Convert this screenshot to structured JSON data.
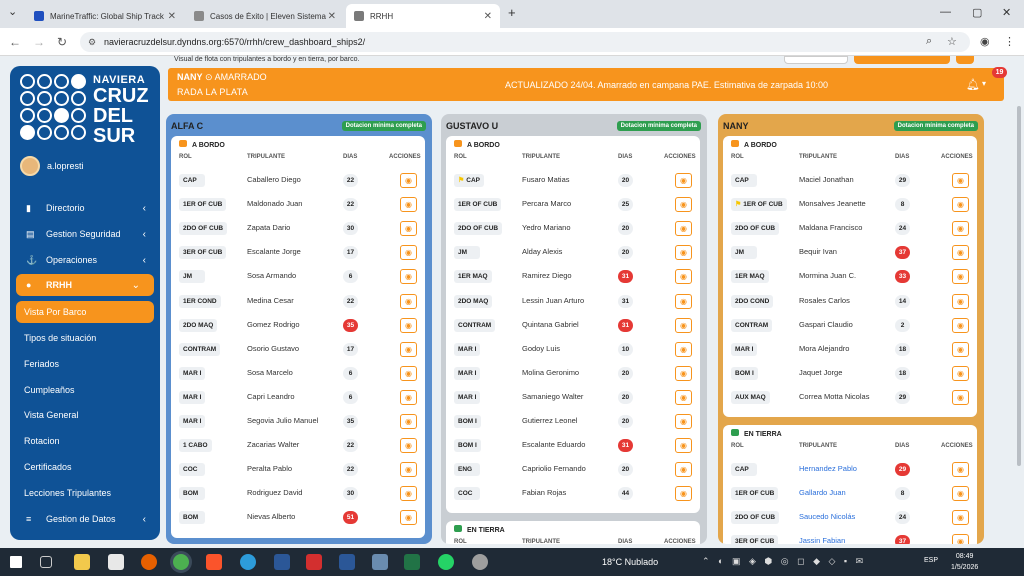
{
  "browser": {
    "tabs": [
      {
        "title": "MarineTraffic: Global Ship Track",
        "fav_color": "#1f4fbf",
        "active": false
      },
      {
        "title": "Casos de Éxito | Eleven Sistema",
        "fav_color": "#8a8a8a",
        "active": false
      },
      {
        "title": "RRHH",
        "fav_color": "#7a7a7a",
        "active": true
      }
    ],
    "new_tab": "+",
    "url": "navieracruzdelsur.dyndns.org:6570/rrhh/crew_dashboard_ships2/"
  },
  "sidebar": {
    "logo": {
      "line1": "NAVIERA",
      "line2": "CRUZ",
      "line3": "DEL",
      "line4": "SUR"
    },
    "user": "a.lopresti",
    "menu": [
      {
        "label": "Directorio",
        "icon": "book-icon"
      },
      {
        "label": "Gestion Seguridad",
        "icon": "clipboard-icon"
      },
      {
        "label": "Operaciones",
        "icon": "anchor-icon"
      },
      {
        "label": "RRHH",
        "icon": "user-icon"
      }
    ],
    "rrhh_sub": [
      "Vista Por Barco",
      "Tipos de situación",
      "Feriados",
      "Cumpleaños",
      "Vista General",
      "Rotacion",
      "Certificados",
      "Lecciones Tripulantes"
    ],
    "last_menu": {
      "label": "Gestion de Datos",
      "icon": "database-icon"
    }
  },
  "top_banner": {
    "text": "Visual de flota con tripulantes a bordo y en tierra, por barco."
  },
  "status": {
    "ship": "NANY",
    "state": "AMARRADO",
    "place": "RADA LA PLATA",
    "message": "ACTUALIZADO 24/04. Amarrado en campana PAE. Estimativa de zarpada 10:00",
    "badge": "19"
  },
  "columns": {
    "rol": "ROL",
    "tripulante": "TRIPULANTE",
    "dias": "DIAS",
    "acciones": "ACCIONES"
  },
  "section_labels": {
    "abordo": "A BORDO",
    "entierra": "EN TIERRA"
  },
  "ships": [
    {
      "name": "ALFA C",
      "badge": "Dotacion mínima completa",
      "color": "#5b8fce",
      "panel_color": "#5b8fce",
      "abordo": [
        {
          "rank": "CAP",
          "name": "Caballero Diego",
          "days": "22",
          "alert": false
        },
        {
          "rank": "1ER OF CUB",
          "name": "Maldonado Juan",
          "days": "22",
          "alert": false
        },
        {
          "rank": "2DO OF CUB",
          "name": "Zapata Dario",
          "days": "30",
          "alert": false
        },
        {
          "rank": "3ER OF CUB",
          "name": "Escalante Jorge",
          "days": "17",
          "alert": false
        },
        {
          "rank": "JM",
          "name": "Sosa Armando",
          "days": "6",
          "alert": false
        },
        {
          "rank": "1ER COND",
          "name": "Medina Cesar",
          "days": "22",
          "alert": false
        },
        {
          "rank": "2DO MAQ",
          "name": "Gomez Rodrigo",
          "days": "35",
          "alert": true
        },
        {
          "rank": "CONTRAM",
          "name": "Osorio Gustavo",
          "days": "17",
          "alert": false
        },
        {
          "rank": "MAR I",
          "name": "Sosa Marcelo",
          "days": "6",
          "alert": false
        },
        {
          "rank": "MAR I",
          "name": "Capri Leandro",
          "days": "6",
          "alert": false
        },
        {
          "rank": "MAR I",
          "name": "Segovia Julio Manuel",
          "days": "35",
          "alert": false
        },
        {
          "rank": "1 CABO",
          "name": "Zacarias Walter",
          "days": "22",
          "alert": false
        },
        {
          "rank": "COC",
          "name": "Peralta Pablo",
          "days": "22",
          "alert": false
        },
        {
          "rank": "BOM",
          "name": "Rodriguez David",
          "days": "30",
          "alert": false
        },
        {
          "rank": "BOM",
          "name": "Nievas Alberto",
          "days": "51",
          "alert": true
        }
      ]
    },
    {
      "name": "GUSTAVO U",
      "badge": "Dotacion mínima completa",
      "color": "#c9ced3",
      "panel_color": "#c9ced3",
      "abordo": [
        {
          "rank": "CAP",
          "name": "Fusaro Matias",
          "days": "20",
          "alert": false,
          "flag": true
        },
        {
          "rank": "1ER OF CUB",
          "name": "Percara Marco",
          "days": "25",
          "alert": false
        },
        {
          "rank": "2DO OF CUB",
          "name": "Yedro Mariano",
          "days": "20",
          "alert": false
        },
        {
          "rank": "JM",
          "name": "Alday Alexis",
          "days": "20",
          "alert": false
        },
        {
          "rank": "1ER MAQ",
          "name": "Ramirez Diego",
          "days": "31",
          "alert": true
        },
        {
          "rank": "2DO MAQ",
          "name": "Lessin Juan Arturo",
          "days": "31",
          "alert": false
        },
        {
          "rank": "CONTRAM",
          "name": "Quintana Gabriel",
          "days": "31",
          "alert": true
        },
        {
          "rank": "MAR I",
          "name": "Godoy Luis",
          "days": "10",
          "alert": false
        },
        {
          "rank": "MAR I",
          "name": "Molina Geronimo",
          "days": "20",
          "alert": false
        },
        {
          "rank": "MAR I",
          "name": "Samaniego Walter",
          "days": "20",
          "alert": false
        },
        {
          "rank": "BOM I",
          "name": "Gutierrez Leonel",
          "days": "20",
          "alert": false
        },
        {
          "rank": "BOM I",
          "name": "Escalante Eduardo",
          "days": "31",
          "alert": true
        },
        {
          "rank": "ENG",
          "name": "Capriolio Fernando",
          "days": "20",
          "alert": false
        },
        {
          "rank": "COC",
          "name": "Fabian Rojas",
          "days": "44",
          "alert": false
        }
      ],
      "entierra_header": true
    },
    {
      "name": "NANY",
      "badge": "Dotacion mínima completa",
      "color": "#e3a64b",
      "panel_color": "#e3a64b",
      "abordo": [
        {
          "rank": "CAP",
          "name": "Maciel Jonathan",
          "days": "29",
          "alert": false
        },
        {
          "rank": "1ER OF CUB",
          "name": "Monsalves Jeanette",
          "days": "8",
          "alert": false,
          "flag": true
        },
        {
          "rank": "2DO OF CUB",
          "name": "Maldana Francisco",
          "days": "24",
          "alert": false
        },
        {
          "rank": "JM",
          "name": "Bequir Ivan",
          "days": "37",
          "alert": true
        },
        {
          "rank": "1ER MAQ",
          "name": "Mormina Juan C.",
          "days": "33",
          "alert": true
        },
        {
          "rank": "2DO COND",
          "name": "Rosales Carlos",
          "days": "14",
          "alert": false
        },
        {
          "rank": "CONTRAM",
          "name": "Gaspari Claudio",
          "days": "2",
          "alert": false
        },
        {
          "rank": "MAR I",
          "name": "Mora Alejandro",
          "days": "18",
          "alert": false
        },
        {
          "rank": "BOM I",
          "name": "Jaquet Jorge",
          "days": "18",
          "alert": false
        },
        {
          "rank": "AUX MAQ",
          "name": "Correa Motta Nicolas",
          "days": "29",
          "alert": false
        }
      ],
      "entierra": [
        {
          "rank": "CAP",
          "name": "Hernandez Pablo",
          "days": "29",
          "alert": true
        },
        {
          "rank": "1ER OF CUB",
          "name": "Gallardo Juan",
          "days": "8",
          "alert": false
        },
        {
          "rank": "2DO OF CUB",
          "name": "Saucedo Nicolás",
          "days": "24",
          "alert": false
        },
        {
          "rank": "3ER OF CUB",
          "name": "Jassin Fabian",
          "days": "37",
          "alert": true
        }
      ]
    }
  ],
  "taskbar": {
    "weather": "18°C Nublado",
    "lang": "ESP",
    "time": "08:49",
    "date": "1/5/2026"
  },
  "colors": {
    "brand_blue": "#0f5296",
    "accent_orange": "#f7941d",
    "alert_red": "#e53935",
    "ok_green": "#2e9e4f"
  }
}
